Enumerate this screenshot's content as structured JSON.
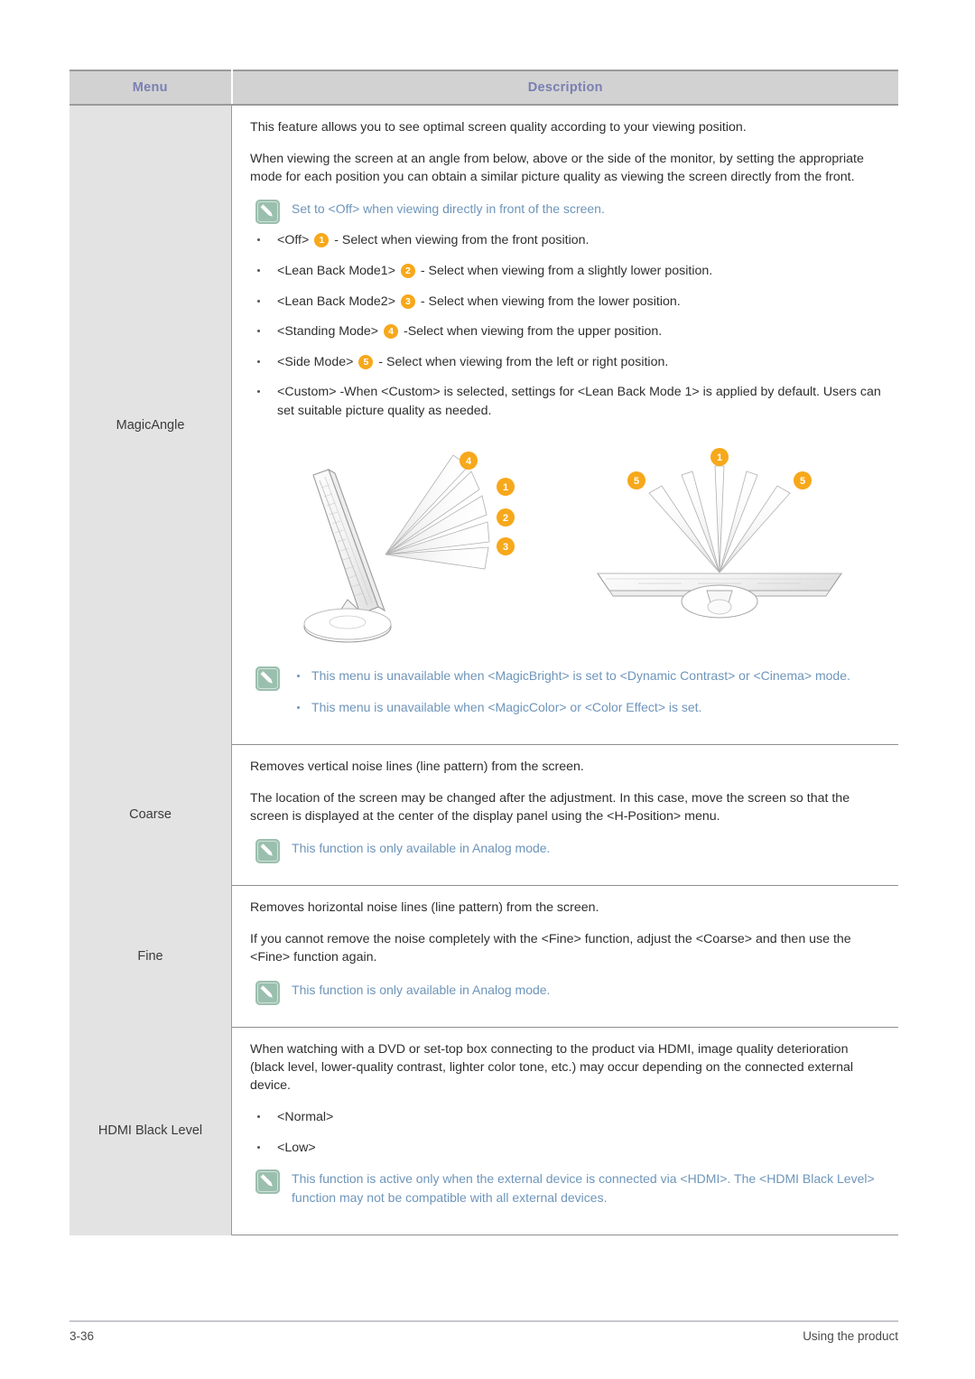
{
  "document": {
    "table_header": {
      "menu": "Menu",
      "description": "Description"
    },
    "colors": {
      "header_bg": "#d2d2d2",
      "header_text": "#7a7fb3",
      "menu_cell_bg": "#e3e3e3",
      "note_text": "#6e95ba",
      "note_icon_bg": "#9bbfae",
      "badge_bg": "#f7a81b",
      "body_text": "#2f2f2f"
    },
    "rows": [
      {
        "menu": "MagicAngle",
        "paragraphs": [
          "This feature allows you to see optimal screen quality according to your viewing position.",
          "When viewing the screen at an angle from below, above or the side of the monitor, by setting the appropriate mode for each position you can obtain a similar picture quality as viewing the screen directly from the front."
        ],
        "note_top": {
          "icon": "note-pencil-icon",
          "text": "Set to <Off> when viewing directly in front of the screen."
        },
        "options": [
          {
            "label": "<Off>",
            "badge": "1",
            "desc": "- Select when viewing from the front position."
          },
          {
            "label": "<Lean Back Mode1>",
            "badge": "2",
            "desc": "- Select when viewing from a slightly lower position."
          },
          {
            "label": "<Lean Back Mode2>",
            "badge": "3",
            "desc": "- Select when viewing from the lower position."
          },
          {
            "label": "<Standing Mode>",
            "badge": "4",
            "desc": "-Select when viewing from the upper position."
          },
          {
            "label": "<Side Mode>",
            "badge": "5",
            "desc": "- Select when viewing from the left or right position."
          },
          {
            "label": "<Custom>",
            "badge": "",
            "desc": "-When <Custom> is selected, settings for <Lean Back Mode 1> is applied by default. Users can set suitable picture quality as needed."
          }
        ],
        "diagram": {
          "name": "magicangle-viewing-position-diagram",
          "side_view": {
            "caption": "Monitor side view with viewing angle cones",
            "badges": [
              "4",
              "1",
              "2",
              "3"
            ]
          },
          "top_view": {
            "caption": "Monitor top-down view with viewing angle cones",
            "badges": [
              "5",
              "1",
              "5"
            ]
          }
        },
        "note_bottom": {
          "icon": "note-pencil-icon",
          "items": [
            "This menu is unavailable when <MagicBright> is set to <Dynamic Contrast> or <Cinema> mode.",
            "This menu is unavailable when <MagicColor> or <Color Effect> is set."
          ]
        }
      },
      {
        "menu": "Coarse",
        "paragraphs": [
          "Removes vertical noise lines (line pattern) from the screen.",
          "The location of the screen may be changed after the adjustment. In this case, move the screen so that the screen is displayed at the center of the display panel using the <H-Position> menu."
        ],
        "note": {
          "icon": "note-pencil-icon",
          "text": "This function is only available in Analog mode."
        }
      },
      {
        "menu": "Fine",
        "paragraphs": [
          "Removes horizontal noise lines (line pattern) from the screen.",
          "If you cannot remove the noise completely with the <Fine> function, adjust the <Coarse> and then use the <Fine> function again."
        ],
        "note": {
          "icon": "note-pencil-icon",
          "text": "This function is only available in Analog mode."
        }
      },
      {
        "menu": "HDMI Black Level",
        "paragraphs": [
          "When watching with a DVD or set-top box connecting to the product via HDMI, image quality deterioration (black level, lower-quality contrast, lighter color tone, etc.) may occur depending on the connected external device."
        ],
        "options": [
          {
            "label": "<Normal>",
            "badge": "",
            "desc": ""
          },
          {
            "label": "<Low>",
            "badge": "",
            "desc": ""
          }
        ],
        "note": {
          "icon": "note-pencil-icon",
          "text": "This function is active only when the external device is connected via <HDMI>. The <HDMI Black Level> function may not be compatible with all external devices."
        }
      }
    ]
  },
  "footer": {
    "page_number": "3-36",
    "section_title": "Using the product"
  }
}
